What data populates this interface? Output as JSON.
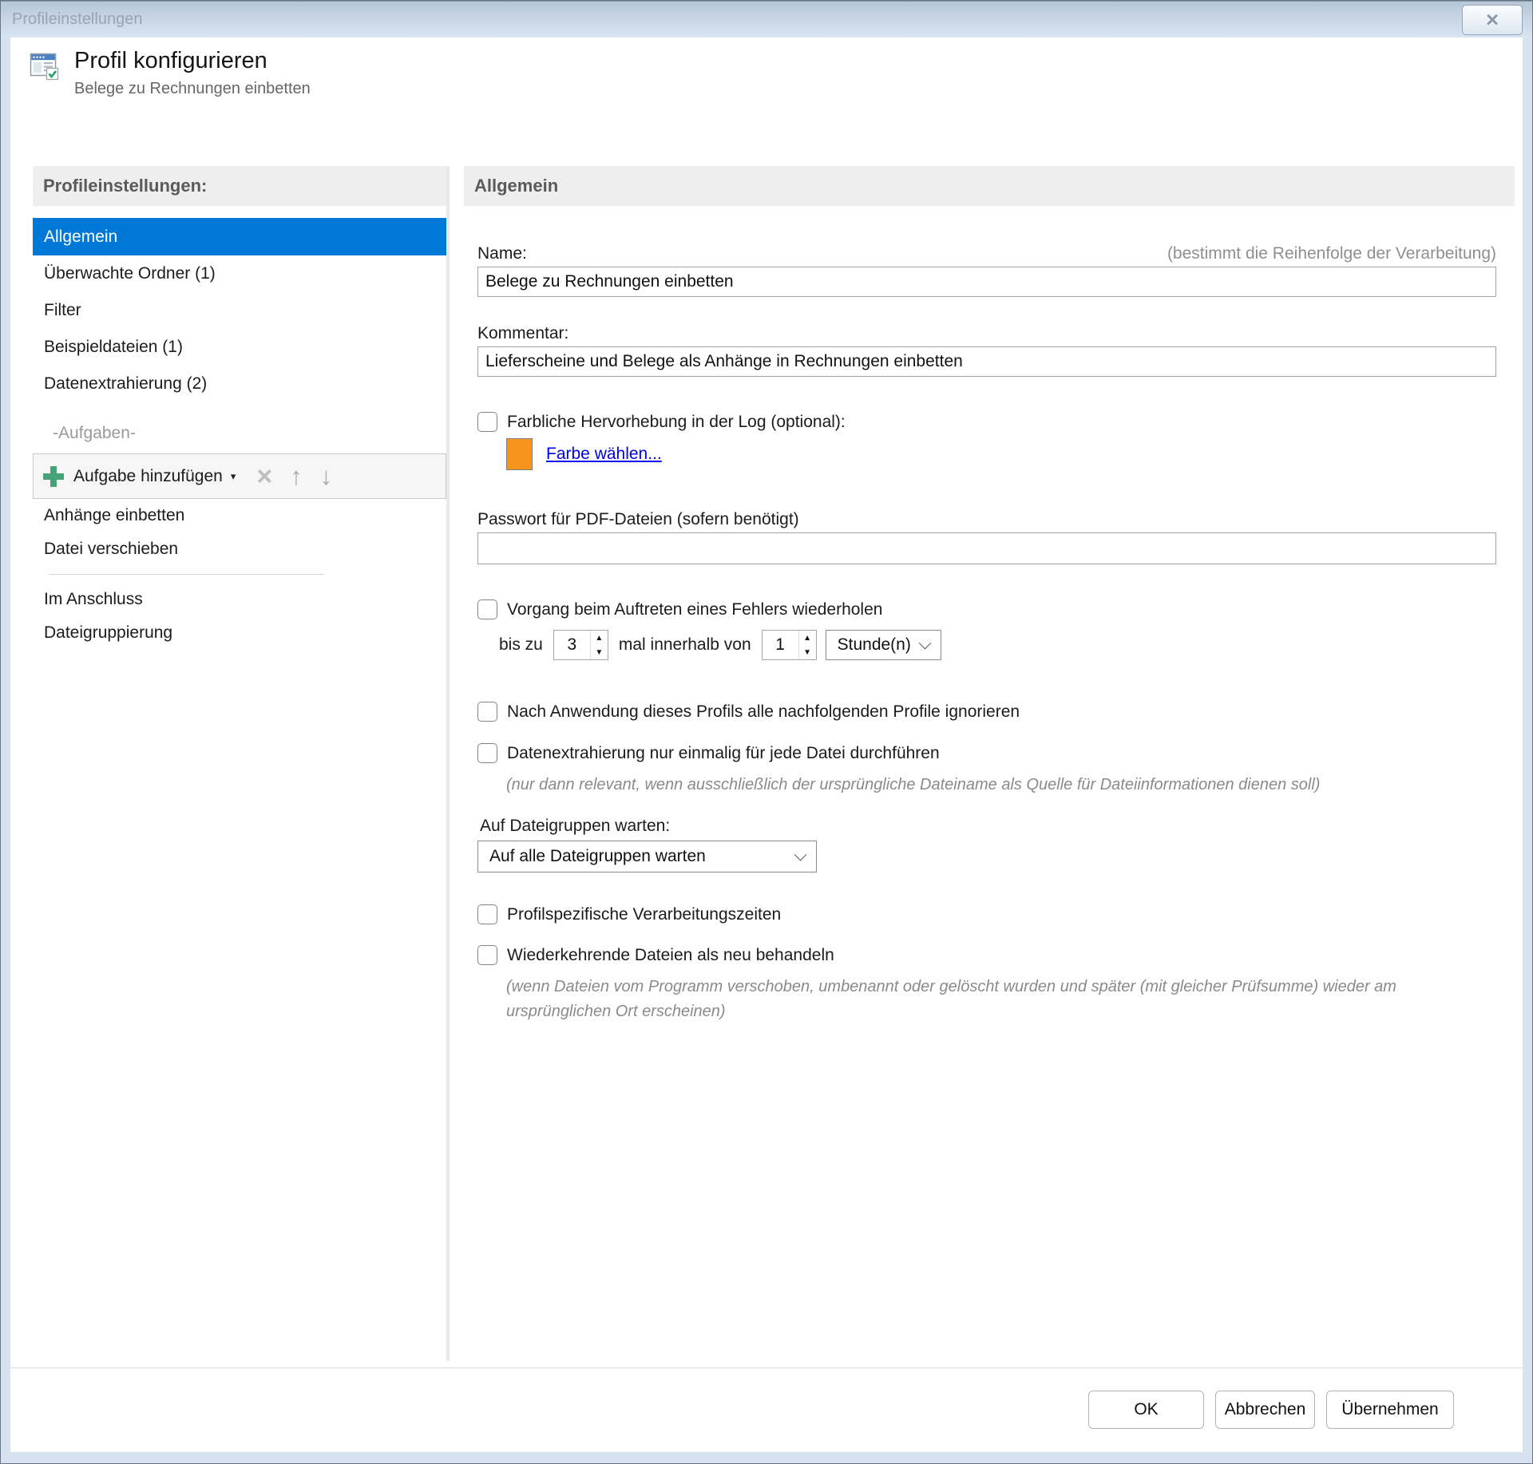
{
  "window": {
    "title": "Profileinstellungen"
  },
  "header": {
    "title": "Profil konfigurieren",
    "subtitle": "Belege zu Rechnungen einbetten"
  },
  "sidebar": {
    "header": "Profileinstellungen:",
    "items": [
      {
        "label": "Allgemein",
        "selected": true
      },
      {
        "label": "Überwachte Ordner (1)",
        "selected": false
      },
      {
        "label": "Filter",
        "selected": false
      },
      {
        "label": "Beispieldateien (1)",
        "selected": false
      },
      {
        "label": "Datenextrahierung (2)",
        "selected": false
      }
    ],
    "tasks_group_label": "-Aufgaben-",
    "toolbar": {
      "add_task_label": "Aufgabe hinzufügen",
      "caret": "▾",
      "delete_icon": "×",
      "up_icon": "↑",
      "down_icon": "↓"
    },
    "task_items": [
      {
        "label": "Anhänge einbetten"
      },
      {
        "label": "Datei verschieben"
      }
    ],
    "bottom_items": [
      {
        "label": "Im Anschluss"
      },
      {
        "label": "Dateigruppierung"
      }
    ]
  },
  "main": {
    "section_title": "Allgemein",
    "name": {
      "label": "Name:",
      "hint": "(bestimmt die Reihenfolge der Verarbeitung)",
      "value": "Belege zu Rechnungen einbetten"
    },
    "comment": {
      "label": "Kommentar:",
      "value": "Lieferscheine und Belege als Anhänge in Rechnungen einbetten"
    },
    "color_highlight": {
      "label": "Farbliche Hervorhebung in der Log (optional):",
      "checked": false,
      "swatch_color": "#f7941d",
      "link_label": "Farbe wählen..."
    },
    "password": {
      "label": "Passwort für PDF-Dateien (sofern benötigt)",
      "value": ""
    },
    "retry": {
      "label": "Vorgang beim Auftreten eines Fehlers wiederholen",
      "checked": false,
      "prefix": "bis zu",
      "count": "3",
      "middle": "mal innerhalb von",
      "interval": "1",
      "unit": "Stunde(n)",
      "up_glyph": "▲",
      "down_glyph": "▼"
    },
    "ignore_following": {
      "label": "Nach Anwendung dieses Profils alle nachfolgenden Profile ignorieren",
      "checked": false
    },
    "extract_once": {
      "label": "Datenextrahierung nur einmalig für jede Datei durchführen",
      "checked": false,
      "note": "(nur dann relevant, wenn ausschließlich der ursprüngliche Dateiname als Quelle für Dateiinformationen dienen soll)"
    },
    "file_groups": {
      "label": "Auf Dateigruppen warten:",
      "value": "Auf alle Dateigruppen warten"
    },
    "processing_times": {
      "label": "Profilspezifische Verarbeitungszeiten",
      "checked": false
    },
    "recurring_files": {
      "label": "Wiederkehrende Dateien als neu behandeln",
      "checked": false,
      "note": "(wenn Dateien vom Programm verschoben, umbenannt oder gelöscht wurden und später (mit gleicher Prüfsumme) wieder am ursprünglichen Ort erscheinen)"
    }
  },
  "footer": {
    "ok": "OK",
    "cancel": "Abbrechen",
    "apply": "Übernehmen"
  },
  "colors": {
    "accent": "#0078d7",
    "link": "#0000ee",
    "swatch": "#f7941d"
  }
}
